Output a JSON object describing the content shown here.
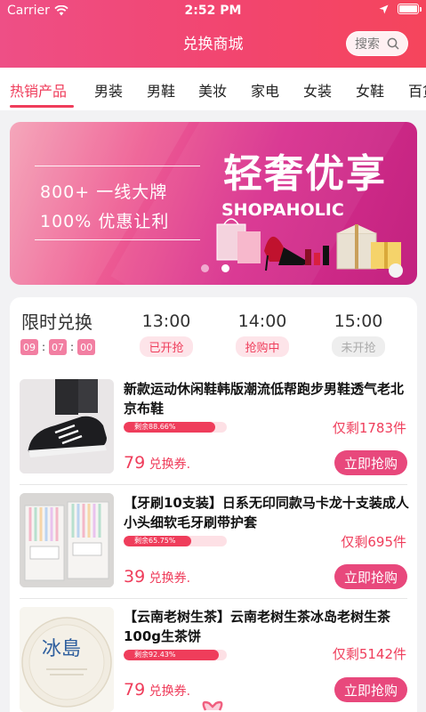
{
  "status_bar": {
    "carrier": "Carrier",
    "time": "2:52 PM"
  },
  "header": {
    "title": "兑换商城",
    "search_placeholder": "搜索"
  },
  "tabs": [
    "热销产品",
    "男装",
    "男鞋",
    "美妆",
    "家电",
    "女装",
    "女鞋",
    "百货"
  ],
  "active_tab": 0,
  "banner": {
    "line1": "800+ 一线大牌",
    "line2": "100% 优惠让利",
    "title": "轻奢优享",
    "subtitle": "SHOPAHOLIC"
  },
  "flash_sale": {
    "title": "限时兑换",
    "countdown": [
      "09",
      "07",
      "00"
    ],
    "slots": [
      {
        "time": "13:00",
        "status": "已开抢"
      },
      {
        "time": "14:00",
        "status": "抢购中"
      },
      {
        "time": "15:00",
        "status": "未开抢"
      }
    ]
  },
  "products": [
    {
      "name": "新款运动休闲鞋韩版潮流低帮跑步男鞋透气老北京布鞋",
      "remain_label": "剩余88.66%",
      "remain_pct": 88.66,
      "stock": "仅剩1783件",
      "price": "79",
      "price_unit": "兑换券.",
      "button": "立即抢购"
    },
    {
      "name": "【牙刷10支装】日系无印同款马卡龙十支装成人小头细软毛牙刷带护套",
      "remain_label": "剩余65.75%",
      "remain_pct": 65.75,
      "stock": "仅剩695件",
      "price": "39",
      "price_unit": "兑换券.",
      "button": "立即抢购"
    },
    {
      "name": "【云南老树生茶】云南老树生茶冰岛老树生茶100g生茶饼",
      "remain_label": "剩余92.43%",
      "remain_pct": 92.43,
      "stock": "仅剩5142件",
      "price": "79",
      "price_unit": "兑换券.",
      "button": "立即抢购"
    }
  ],
  "colors": {
    "accent": "#ef3d5b",
    "header": "#f2456f",
    "button": "#e8487c"
  },
  "thumb_labels": {
    "tea": "冰島"
  }
}
